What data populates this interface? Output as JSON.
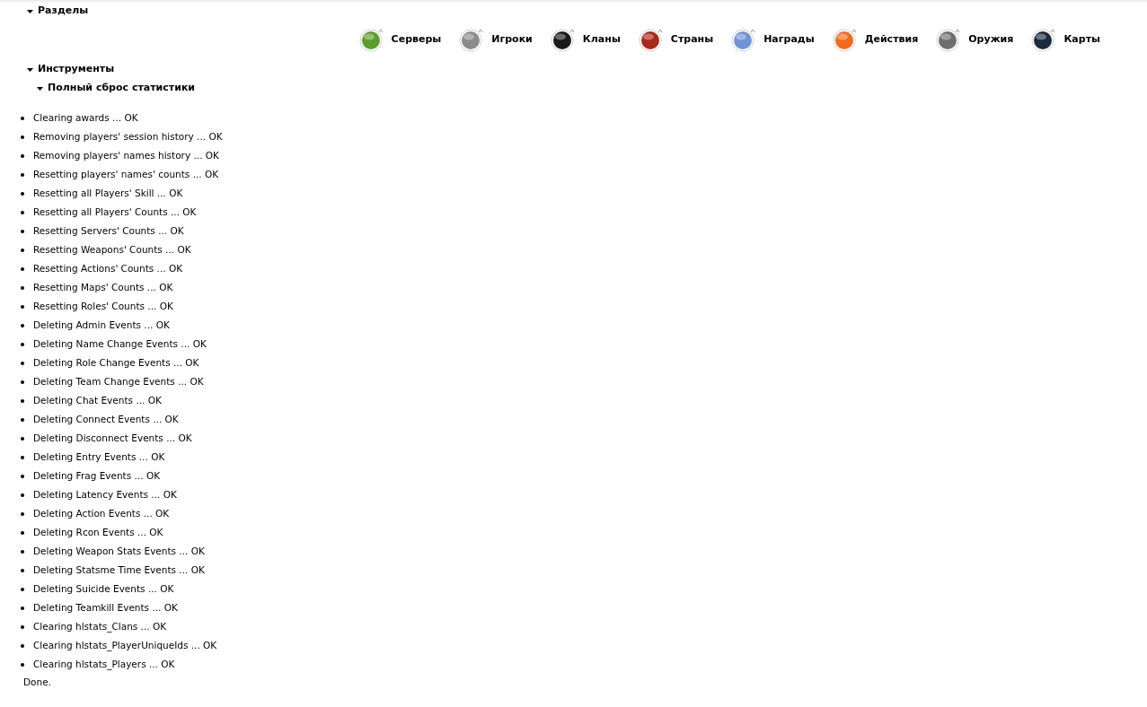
{
  "sections": [
    {
      "title": "Разделы",
      "expanded": true
    }
  ],
  "nav": [
    {
      "label": "Серверы",
      "color": "#5a9e2c"
    },
    {
      "label": "Игроки",
      "color": "#8c8c8c"
    },
    {
      "label": "Кланы",
      "color": "#1a1a1a"
    },
    {
      "label": "Страны",
      "color": "#a8291b"
    },
    {
      "label": "Награды",
      "color": "#6f95d6"
    },
    {
      "label": "Действия",
      "color": "#f26b1d"
    },
    {
      "label": "Оружия",
      "color": "#6e6e6e"
    },
    {
      "label": "Карты",
      "color": "#1c2a3d"
    }
  ],
  "tools": {
    "title": "Инструменты",
    "expanded": true
  },
  "subsection": {
    "title": "Полный сброс статистики",
    "expanded": true
  },
  "log": [
    "Clearing awards ... OK",
    "Removing players' session history ... OK",
    "Removing players' names history ... OK",
    "Resetting players' names' counts ... OK",
    "Resetting all Players' Skill ... OK",
    "Resetting all Players' Counts ... OK",
    "Resetting Servers' Counts ... OK",
    "Resetting Weapons' Counts ... OK",
    "Resetting Actions' Counts ... OK",
    "Resetting Maps' Counts ... OK",
    "Resetting Roles' Counts ... OK",
    "Deleting Admin Events ... OK",
    "Deleting Name Change Events ... OK",
    "Deleting Role Change Events ... OK",
    "Deleting Team Change Events ... OK",
    "Deleting Chat Events ... OK",
    "Deleting Connect Events ... OK",
    "Deleting Disconnect Events ... OK",
    "Deleting Entry Events ... OK",
    "Deleting Frag Events ... OK",
    "Deleting Latency Events ... OK",
    "Deleting Action Events ... OK",
    "Deleting Rcon Events ... OK",
    "Deleting Weapon Stats Events ... OK",
    "Deleting Statsme Time Events ... OK",
    "Deleting Suicide Events ... OK",
    "Deleting Teamkill Events ... OK",
    "Clearing hlstats_Clans ... OK",
    "Clearing hlstats_PlayerUniqueIds ... OK",
    "Clearing hlstats_Players ... OK"
  ],
  "footer": "Done."
}
